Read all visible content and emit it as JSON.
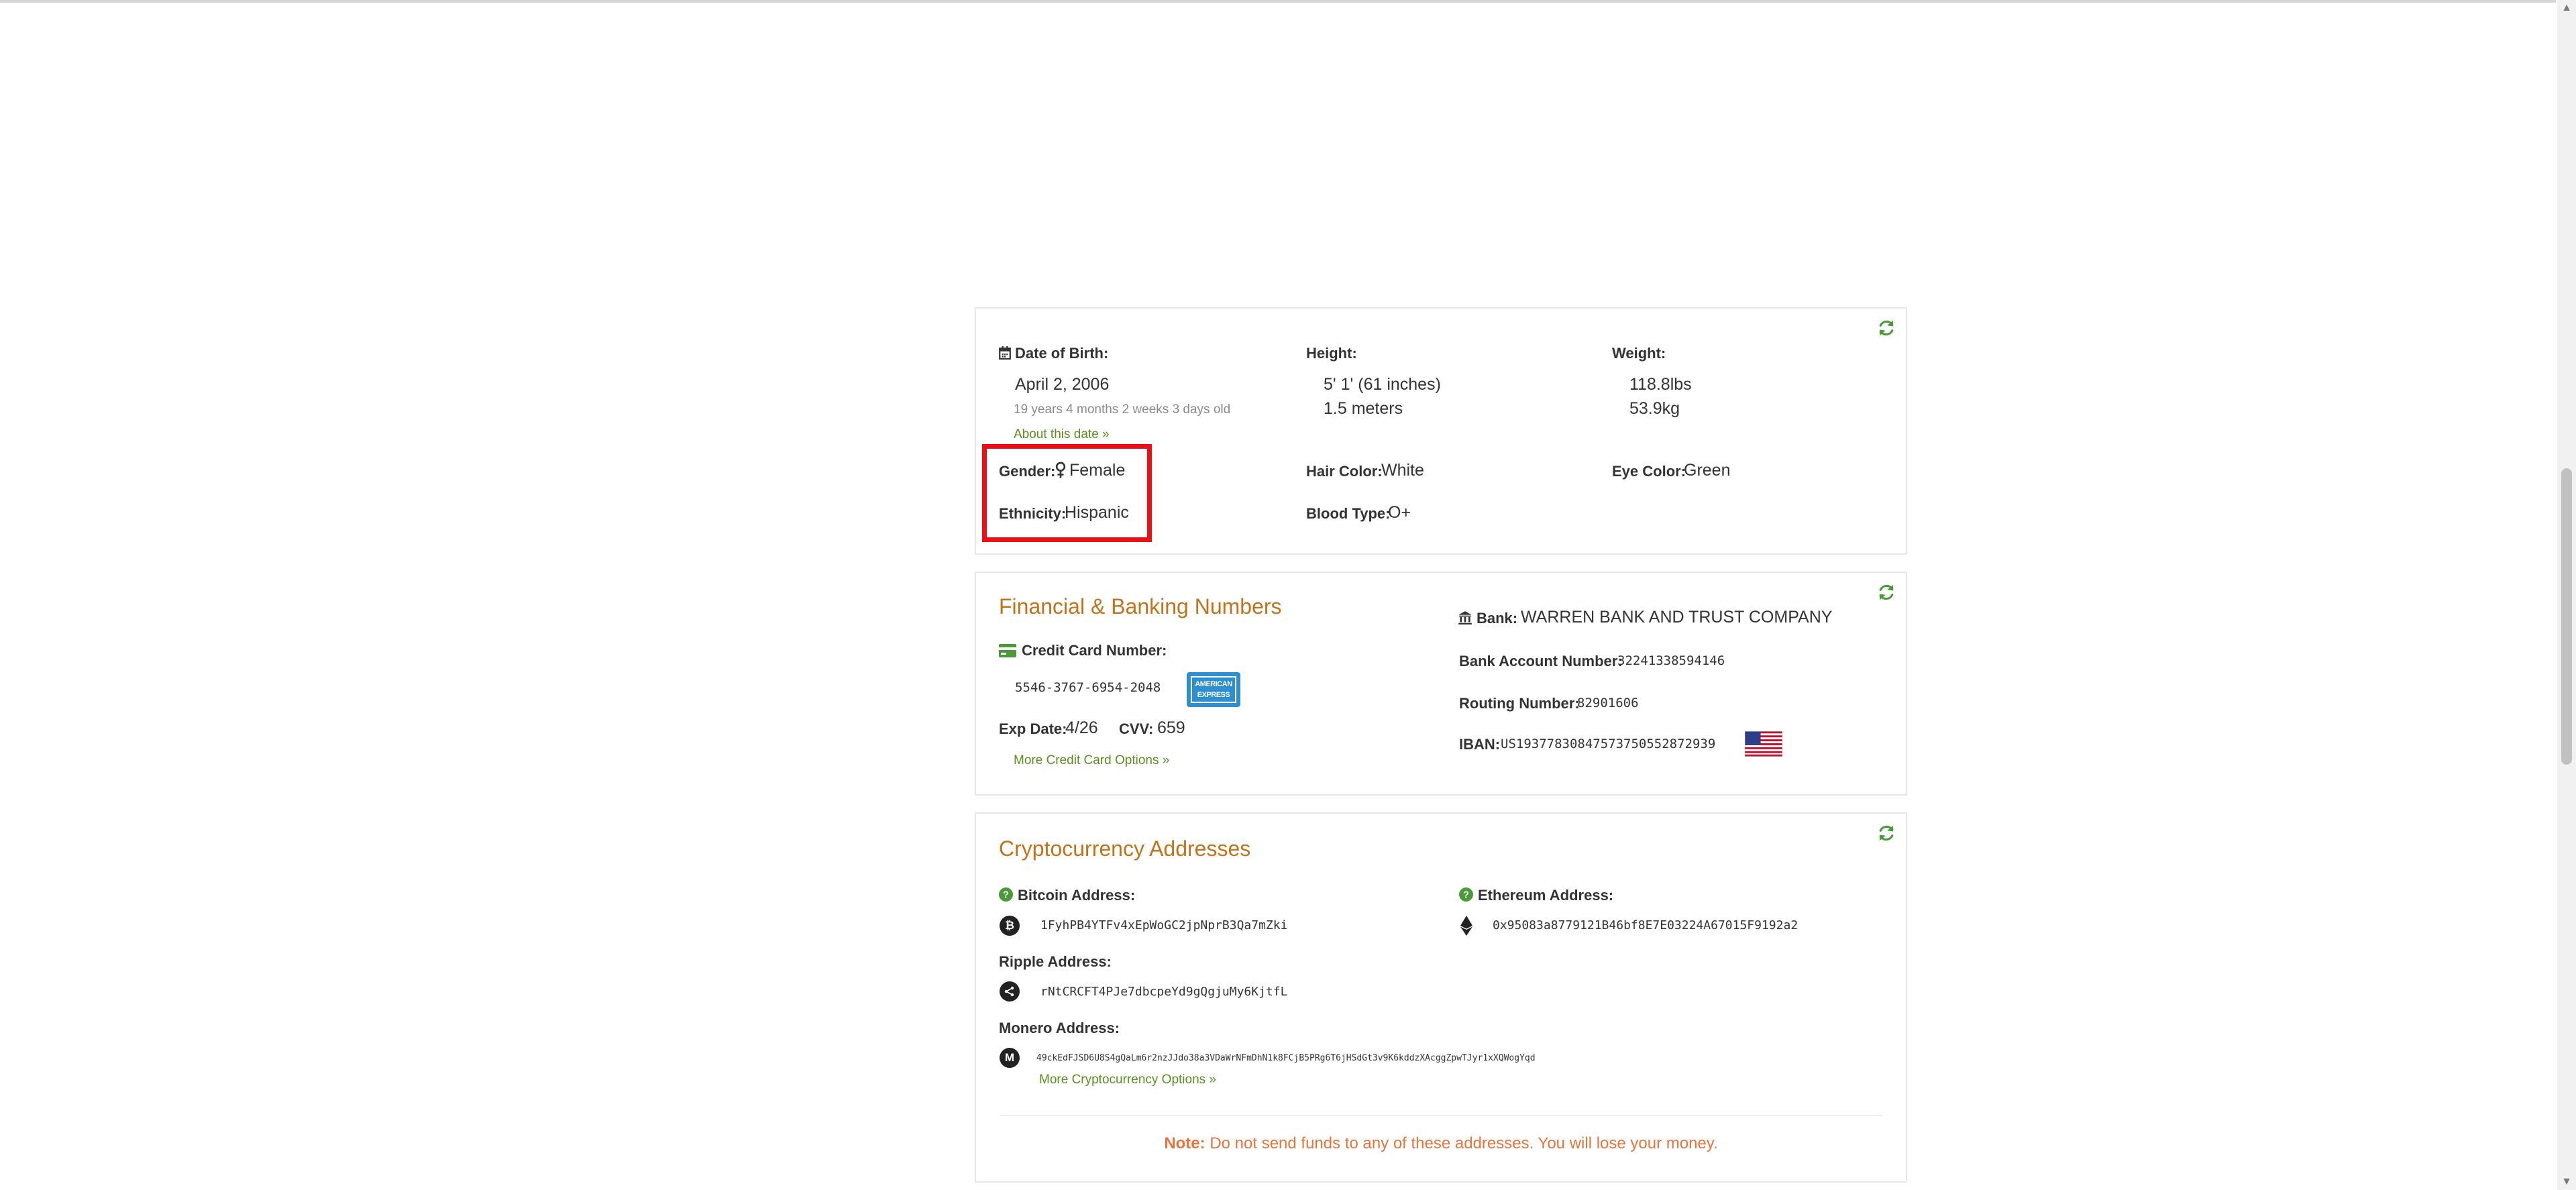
{
  "personal": {
    "dob_label": "Date of Birth:",
    "dob_value": "April 2, 2006",
    "age": "19 years 4 months 2 weeks 3 days old",
    "about_link": "About this date »",
    "height_label": "Height:",
    "height_imperial": "5' 1' (61 inches)",
    "height_metric": "1.5 meters",
    "weight_label": "Weight:",
    "weight_lbs": "118.8lbs",
    "weight_kg": "53.9kg",
    "gender_label": "Gender:",
    "gender_value": "Female",
    "ethnicity_label": "Ethnicity:",
    "ethnicity_value": "Hispanic",
    "hair_label": "Hair Color:",
    "hair_value": "White",
    "blood_label": "Blood Type:",
    "blood_value": "O+",
    "eye_label": "Eye Color:",
    "eye_value": "Green"
  },
  "finance": {
    "title": "Financial & Banking Numbers",
    "cc_label": "Credit Card Number:",
    "cc_number": "5546-3767-6954-2048",
    "card_brand_text": "AMERICAN EXPRESS",
    "exp_label": "Exp Date:",
    "exp_value": "4/26",
    "cvv_label": "CVV:",
    "cvv_value": "659",
    "more_cc_link": "More Credit Card Options »",
    "bank_label": "Bank:",
    "bank_value": "WARREN BANK AND TRUST COMPANY",
    "account_label": "Bank Account Number:",
    "account_value": "32241338594146",
    "routing_label": "Routing Number:",
    "routing_value": "82901606",
    "iban_label": "IBAN:",
    "iban_value": "US19377830847573750552872939"
  },
  "crypto": {
    "title": "Cryptocurrency Addresses",
    "bitcoin_label": "Bitcoin Address:",
    "bitcoin_value": "1FyhPB4YTFv4xEpWoGC2jpNprB3Qa7mZki",
    "ethereum_label": "Ethereum Address:",
    "ethereum_value": "0x95083a8779121B46bf8E7E03224A67015F9192a2",
    "ripple_label": "Ripple Address:",
    "ripple_value": "rNtCRCFT4PJe7dbcpeYd9gQgjuMy6KjtfL",
    "monero_label": "Monero Address:",
    "monero_value": "49ckEdFJSD6U8S4gQaLm6r2nzJJdo38a3VDaWrNFmDhN1k8FCjB5PRg6T6jHSdGt3v9K6kddzXAcggZpwTJyr1xXQWogYqd",
    "more_crypto_link": "More Cryptocurrency Options »",
    "note_label": "Note:",
    "note_text": "Do not send funds to any of these addresses. You will lose your money."
  },
  "colors": {
    "section_title": "#c0731b",
    "link": "#5a8f1f",
    "highlight": "#ee0f15",
    "note": "#e8743b",
    "refresh_icon": "#4a9a3a"
  },
  "icons": [
    "calendar-icon",
    "gender-female-icon",
    "credit-card-icon",
    "bank-icon",
    "question-circle-icon",
    "bitcoin-icon",
    "ethereum-icon",
    "ripple-icon",
    "monero-icon",
    "us-flag-icon",
    "refresh-icon",
    "amex-logo"
  ]
}
